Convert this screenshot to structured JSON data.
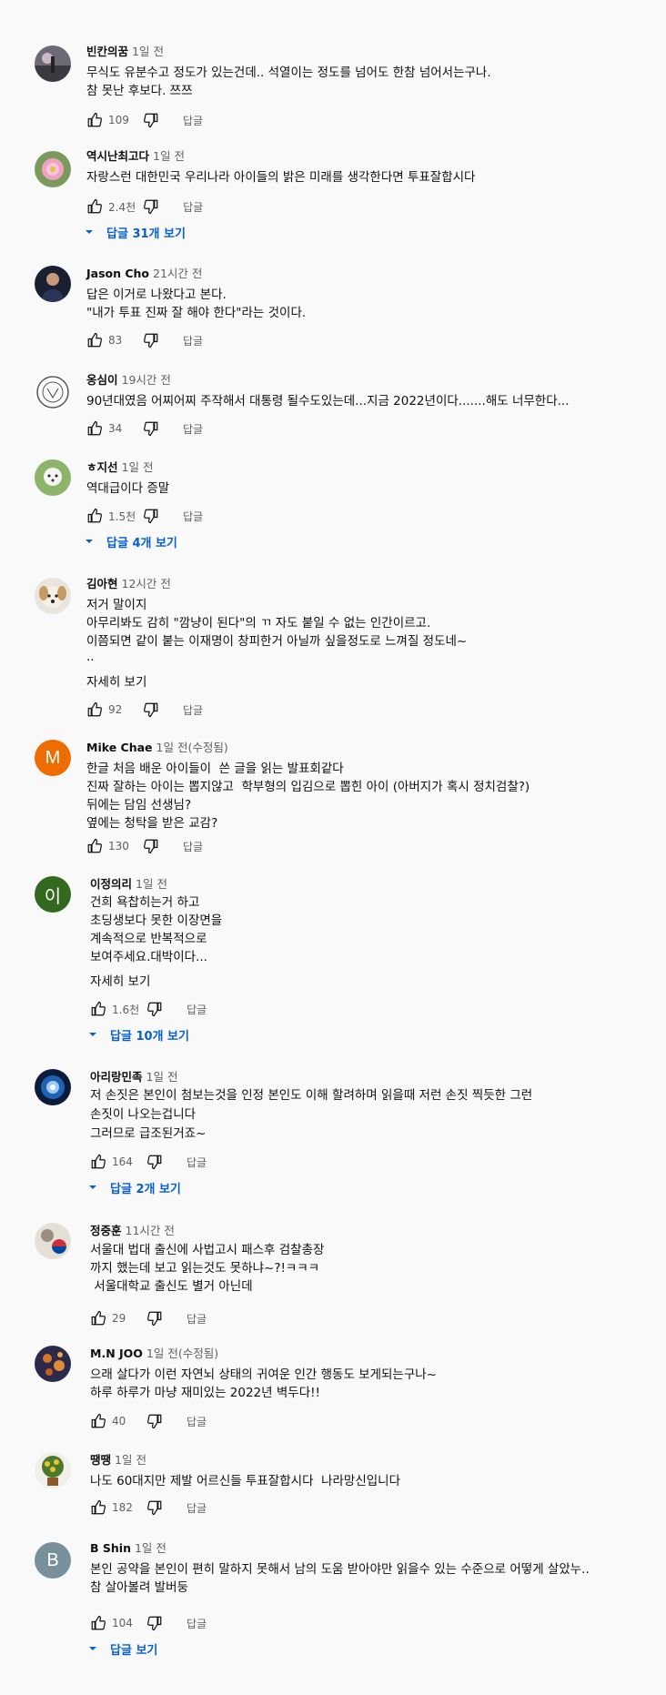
{
  "comments": [
    {
      "author": "빈칸의꿈",
      "time": "1일 전",
      "lines": [
        "무식도 유분수고 정도가 있는건데.. 석열이는 정도를 넘어도 한참 넘어서는구나.",
        "참 못난 후보다. 쯔쯔"
      ],
      "likes": "109",
      "reply_label": "답글",
      "avatar": "landscape-photo-avatar"
    },
    {
      "author": "역시난최고다",
      "time": "1일 전",
      "lines": [
        "자랑스런 대한민국 우리나라 아이들의 밝은 미래를 생각한다면 투표잘합시다"
      ],
      "likes": "2.4천",
      "reply_label": "답글",
      "replies_label": "답글 31개 보기",
      "avatar": "flower-photo-avatar"
    },
    {
      "author": "Jason Cho",
      "time": "21시간 전",
      "lines": [
        "답은 이거로 나왔다고 본다.",
        "\"내가 투표 진짜 잘 해야 한다\"라는 것이다."
      ],
      "likes": "83",
      "reply_label": "답글",
      "avatar": "person-photo-avatar"
    },
    {
      "author": "옹심이",
      "time": "19시간 전",
      "lines": [
        "90년대였음 어찌어찌 주작해서 대통령 될수도있는데...지금 2022년이다.......해도 너무한다..."
      ],
      "likes": "34",
      "reply_label": "답글",
      "avatar": "logo-avatar"
    },
    {
      "author": "ㅎ지선",
      "time": "1일 전",
      "lines": [
        "역대급이다 증말"
      ],
      "likes": "1.5천",
      "reply_label": "답글",
      "replies_label": "답글 4개 보기",
      "avatar": "dog-photo-avatar"
    },
    {
      "author": "김아현",
      "time": "12시간 전",
      "lines": [
        "저거 말이지",
        "아무리봐도 감히 \"깜냥이 된다\"의 ㄲ 자도 붙일 수 없는 인간이르고.",
        "이쯤되면 같이 붙는 이재명이 창피한거 아닐까 싶을정도로 느껴질 정도네~",
        ".."
      ],
      "more_label": "자세히 보기",
      "likes": "92",
      "reply_label": "답글",
      "avatar": "puppy-photo-avatar"
    },
    {
      "author": "Mike Chae",
      "time": "1일 전(수정됨)",
      "lines": [
        "한글 처음 배운 아이들이  쓴 글을 읽는 발표회같다",
        "진짜 잘하는 아이는 뽑지않고  학부형의 입김으로 뽑힌 아이 (아버지가 혹시 정치검찰?)",
        "뒤에는 담임 선생님?",
        "옆에는 청탁을 받은 교감?"
      ],
      "likes": "130",
      "reply_label": "답글",
      "avatar_letter": "M",
      "avatar_color": "#ef6c00"
    },
    {
      "author": "이정의리",
      "time": "1일 전",
      "lines": [
        "건희 욕찹히는거 하고",
        "초딩생보다 못한 이장면을",
        "계속적으로 반복적으로",
        "보여주세요.대박이다..."
      ],
      "more_label": "자세히 보기",
      "likes": "1.6천",
      "reply_label": "답글",
      "replies_label": "답글 10개 보기",
      "avatar_letter": "이",
      "avatar_color": "#33691e"
    },
    {
      "author": "아리랑민족",
      "time": "1일 전",
      "lines": [
        "저 손짓은 본인이 첨보는것을 인정 본인도 이해 할려하며 읽을때 저런 손짓 찍듯한 그런",
        "손짓이 나오는겁니다",
        "그러므로 급조된거죠~"
      ],
      "likes": "164",
      "reply_label": "답글",
      "replies_label": "답글 2개 보기",
      "avatar": "earth-photo-avatar"
    },
    {
      "author": "정중훈",
      "time": "11시간 전",
      "lines": [
        "서울대 법대 출신에 사법고시 패스후 검찰총장",
        "까지 했는데 보고 읽는것도 못하냐~?!ㅋㅋㅋ",
        " 서울대학교 출신도 별거 아닌데"
      ],
      "likes": "29",
      "reply_label": "답글",
      "avatar": "flag-photo-avatar"
    },
    {
      "author": "M.N JOO",
      "time": "1일 전(수정됨)",
      "lines": [
        "으래 살다가 이런 자연뇌 상태의 귀여운 인간 행동도 보게되는구나~",
        "하루 하루가 마냥 재미있는 2022년 벽두다!!"
      ],
      "likes": "40",
      "reply_label": "답글",
      "avatar": "painting-photo-avatar"
    },
    {
      "author": "땡땡",
      "time": "1일 전",
      "lines": [
        "나도 60대지만 제발 어르신들 투표잘합시다  나라망신입니다"
      ],
      "likes": "182",
      "reply_label": "답글",
      "avatar": "bouquet-photo-avatar"
    },
    {
      "author": "B Shin",
      "time": "1일 전",
      "lines": [
        "본인 공약을 본인이 편히 말하지 못해서 남의 도움 받아야만 읽을수 있는 수준으로 어떻게 살았누..",
        "참 살아볼려 발버둥"
      ],
      "likes": "104",
      "reply_label": "답글",
      "replies_label": "답글 보기",
      "avatar_letter": "B",
      "avatar_color": "#78909c"
    }
  ]
}
